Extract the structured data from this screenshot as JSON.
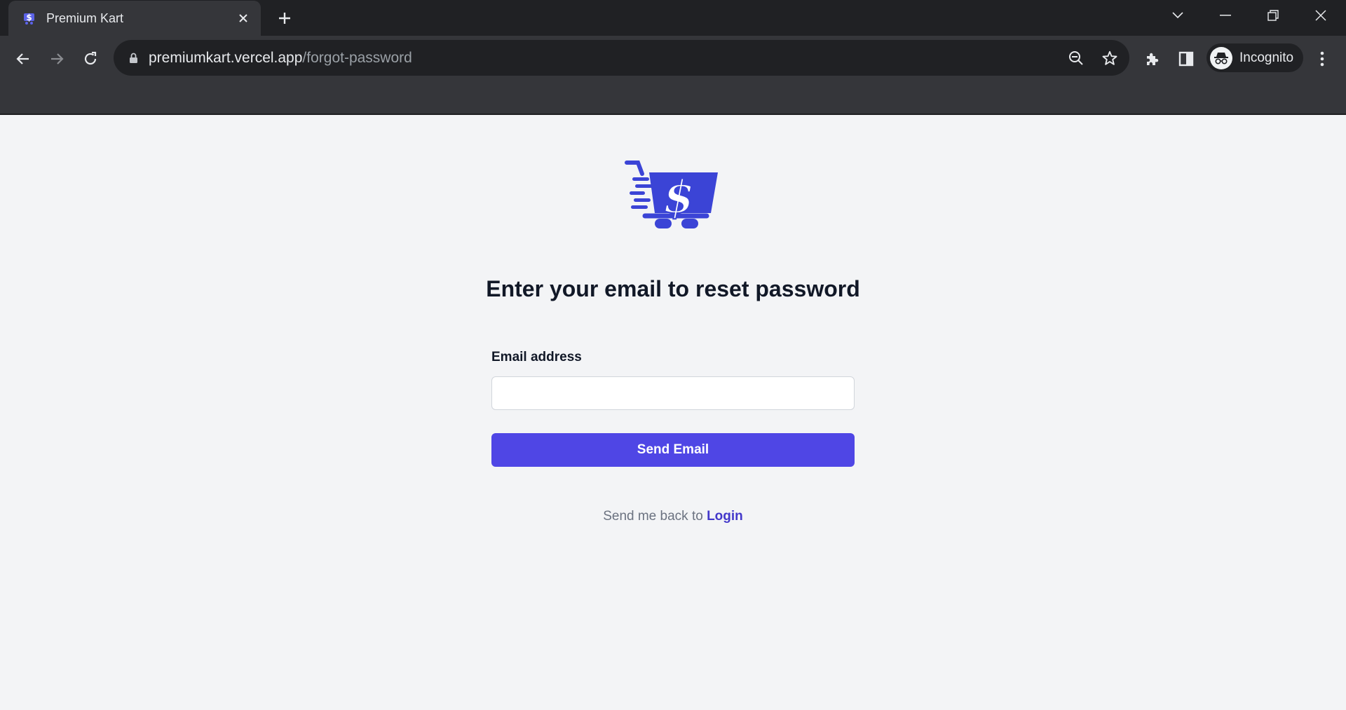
{
  "browser": {
    "tab_title": "Premium Kart",
    "url_domain": "premiumkart.vercel.app",
    "url_path": "/forgot-password",
    "profile_label": "Incognito",
    "icons": [
      "back-arrow-icon",
      "forward-arrow-icon",
      "reload-icon",
      "lock-icon",
      "zoom-out-icon",
      "star-icon",
      "puzzle-icon",
      "side-panel-icon",
      "incognito-icon",
      "more-vert-icon"
    ]
  },
  "page": {
    "heading": "Enter your email to reset password",
    "email_label": "Email address",
    "email_value": "",
    "email_placeholder": "",
    "send_button": "Send Email",
    "back_text": "Send me back to ",
    "login_link": "Login"
  },
  "colors": {
    "accent": "#4f46e5",
    "link": "#4338ca",
    "logo_blue": "#3b44d6"
  }
}
